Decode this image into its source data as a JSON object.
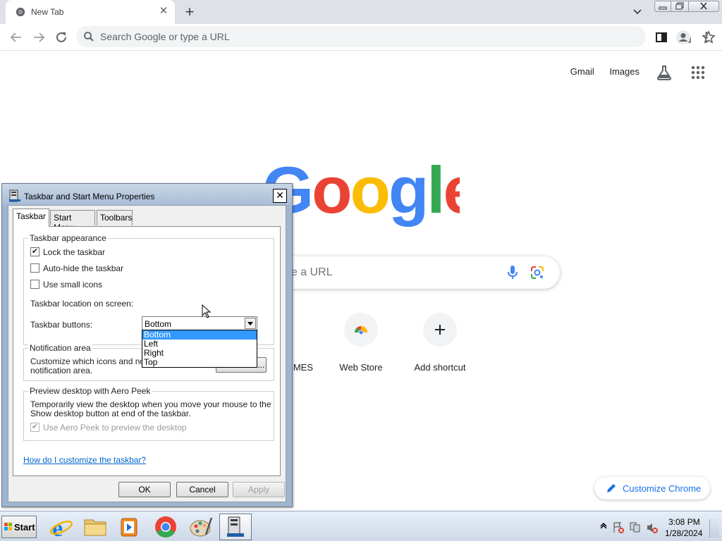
{
  "browser": {
    "tab_title": "New Tab",
    "omnibox_placeholder": "Search Google or type a URL"
  },
  "ntp": {
    "links": [
      "Gmail",
      "Images"
    ],
    "search_placeholder": "ype a URL",
    "shortcuts": [
      {
        "label": "MES",
        "icon": "globe-icon"
      },
      {
        "label": "Web Store",
        "icon": "webstore-icon"
      },
      {
        "label": "Add shortcut",
        "icon": "plus-icon"
      }
    ],
    "customize_label": "Customize Chrome"
  },
  "dialog": {
    "title": "Taskbar and Start Menu Properties",
    "tabs": [
      "Taskbar",
      "Start Menu",
      "Toolbars"
    ],
    "appearance": {
      "group_label": "Taskbar appearance",
      "lock_label": "Lock the taskbar",
      "lock_checked": true,
      "autohide_label": "Auto-hide the taskbar",
      "autohide_checked": false,
      "small_icons_label": "Use small icons",
      "small_icons_checked": false,
      "location_label": "Taskbar location on screen:",
      "location_value": "Bottom",
      "location_options": [
        "Bottom",
        "Left",
        "Right",
        "Top"
      ],
      "buttons_label": "Taskbar buttons:"
    },
    "notification": {
      "group_label": "Notification area",
      "line1": "Customize which icons and notifications appear in the",
      "line2": "notification area.",
      "customize_button": "Customize..."
    },
    "aero": {
      "group_label": "Preview desktop with Aero Peek",
      "line1": "Temporarily view the desktop when you move your mouse to the",
      "line2": "Show desktop button at end of the taskbar.",
      "checkbox_label": "Use Aero Peek to preview the desktop",
      "checkbox_checked": true,
      "checkbox_disabled": true
    },
    "help_link": "How do I customize the taskbar?",
    "ok_label": "OK",
    "cancel_label": "Cancel",
    "apply_label": "Apply"
  },
  "taskbar": {
    "start_label": "Start",
    "apps": [
      "internet-explorer-icon",
      "file-explorer-icon",
      "media-player-icon",
      "chrome-icon",
      "paint-icon",
      "taskbar-properties-icon"
    ],
    "clock_time": "3:08 PM",
    "clock_date": "1/28/2024"
  },
  "colors": {
    "google_blue": "#4285f4",
    "google_red": "#ea4335",
    "google_yellow": "#fbbc05",
    "google_green": "#34a853",
    "link_blue": "#1a73e8",
    "selection_blue": "#3399ff"
  }
}
